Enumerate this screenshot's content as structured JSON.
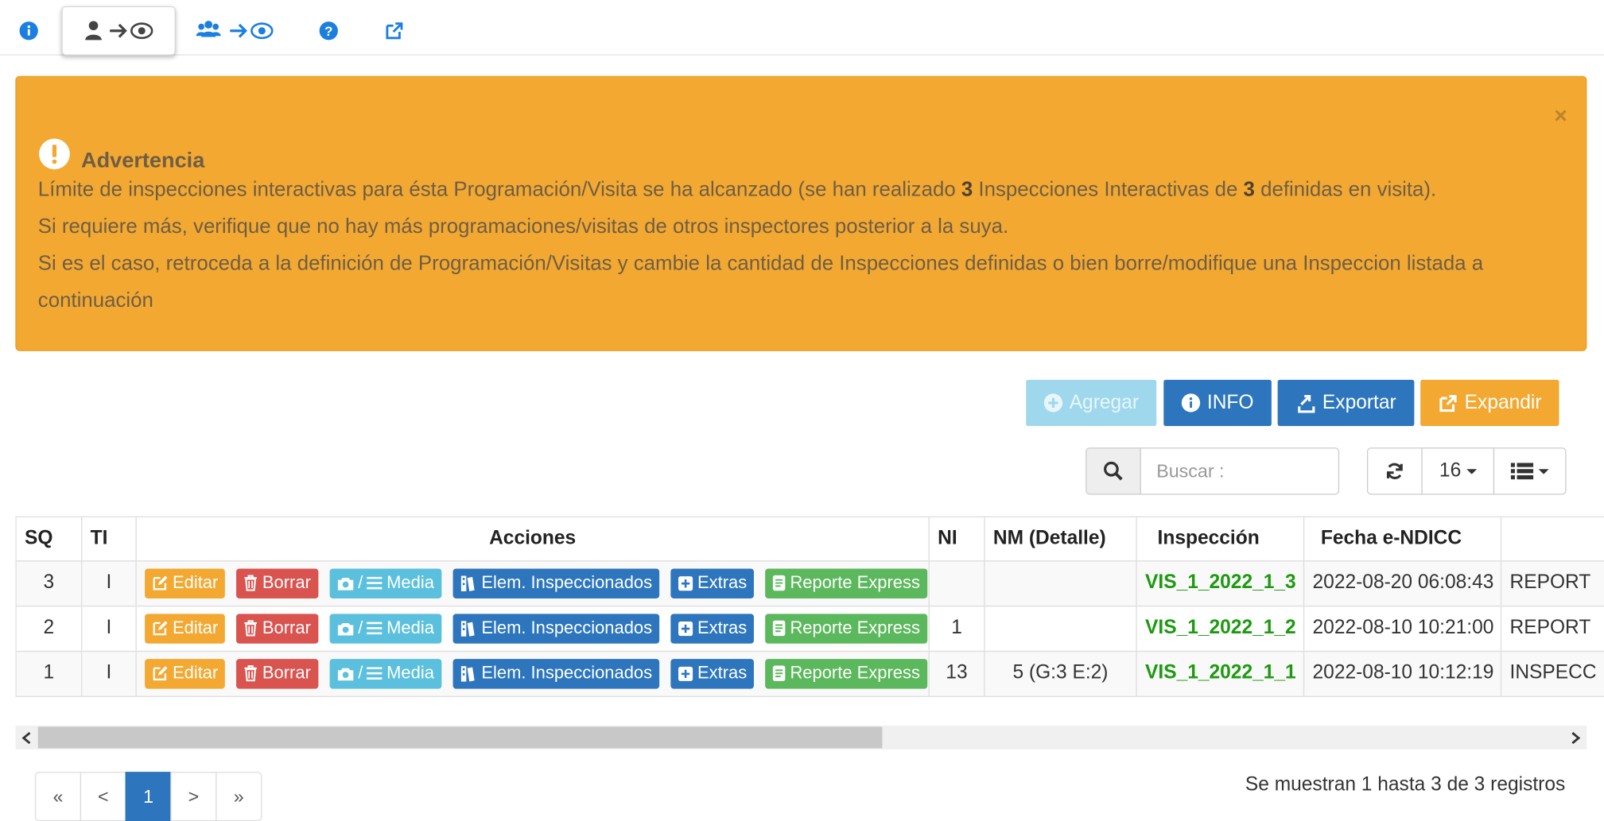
{
  "colors": {
    "warning": "#f3a831",
    "primary": "#2d76bd",
    "info": "#5bc0de",
    "danger": "#d9534f",
    "success": "#5cb85c",
    "link": "#1b7fe0",
    "inspection_text": "#1c9a10"
  },
  "tabs": [
    {
      "icon": "info-circle-icon"
    },
    {
      "icon": "user-to-eye-icon",
      "active": true
    },
    {
      "icon": "users-to-eye-icon"
    },
    {
      "icon": "question-circle-icon"
    },
    {
      "icon": "external-link-icon"
    }
  ],
  "alert": {
    "title": "Advertencia",
    "line1_a": "Límite de inspecciones interactivas para ésta Programación/Visita se ha alcanzado (se han realizado ",
    "line1_n1": "3",
    "line1_b": " Inspecciones Interactivas de ",
    "line1_n2": "3",
    "line1_c": " definidas en visita).",
    "line2": "Si requiere más, verifique que no hay más programaciones/visitas de otros inspectores posterior a la suya.",
    "line3": "Si es el caso, retroceda a la definición de Programación/Visitas y cambie la cantidad de Inspecciones definidas o bien borre/modifique una Inspeccion listada a continuación",
    "close": "×"
  },
  "toolbar": {
    "agregar": "Agregar",
    "info": "INFO",
    "exportar": "Exportar",
    "expandir": "Expandir"
  },
  "search": {
    "placeholder": "Buscar :"
  },
  "page_size": "16",
  "table": {
    "headers": [
      "SQ",
      "TI",
      "Acciones",
      "NI",
      "NM (Detalle)",
      "Inspección",
      "Fecha e-NDICC",
      ""
    ],
    "action_labels": {
      "editar": "Editar",
      "borrar": "Borrar",
      "media_sep": "/",
      "media": "Media",
      "elem": "Elem. Inspeccionados",
      "extras": "Extras",
      "reporte": "Reporte Express"
    },
    "rows": [
      {
        "sq": "3",
        "ti": "I",
        "ni": "",
        "nm": "",
        "insp": "VIS_1_2022_1_3",
        "fecha": "2022-08-20 06:08:43",
        "extra": "REPORT"
      },
      {
        "sq": "2",
        "ti": "I",
        "ni": "1",
        "nm": "",
        "insp": "VIS_1_2022_1_2",
        "fecha": "2022-08-10 10:21:00",
        "extra": "REPORT"
      },
      {
        "sq": "1",
        "ti": "I",
        "ni": "13",
        "nm": "5 (G:3 E:2)",
        "insp": "VIS_1_2022_1_1",
        "fecha": "2022-08-10 10:12:19",
        "extra": "INSPECC"
      }
    ]
  },
  "pagination": {
    "first": "«",
    "prev": "<",
    "current": "1",
    "next": ">",
    "last": "»"
  },
  "summary": "Se muestran 1 hasta 3 de 3 registros"
}
